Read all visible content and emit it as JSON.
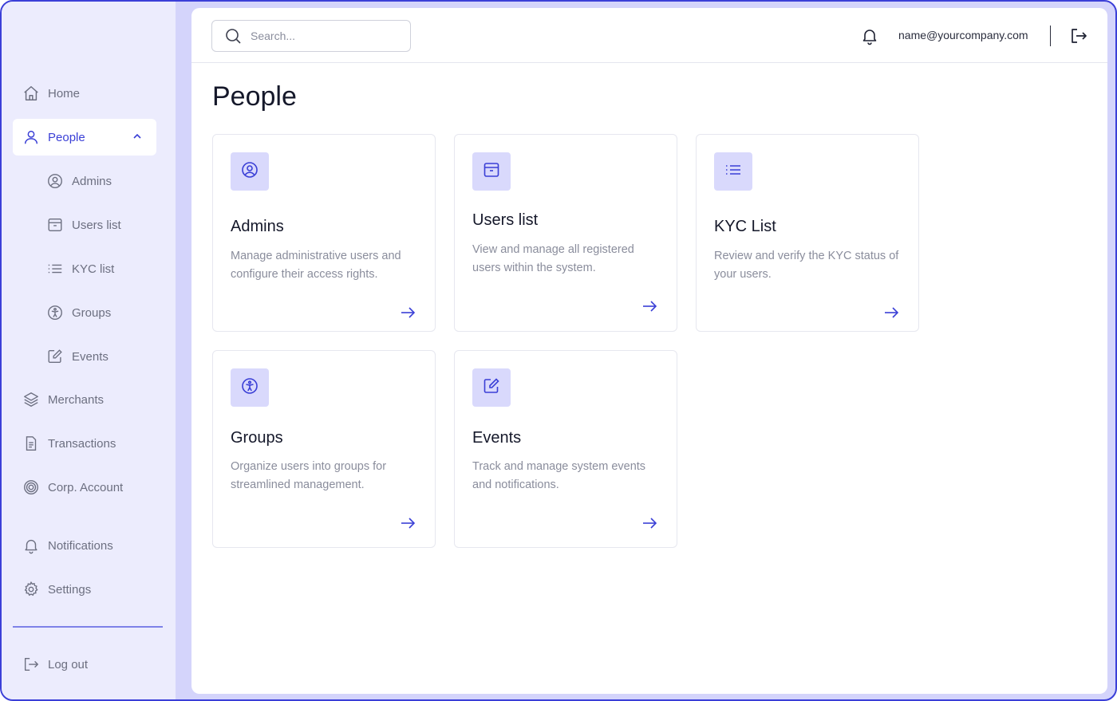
{
  "sidebar": {
    "items": [
      {
        "label": "Home",
        "icon": "home-icon"
      },
      {
        "label": "People",
        "icon": "user-icon",
        "active": true
      },
      {
        "label": "Admins",
        "icon": "user-circle-icon"
      },
      {
        "label": "Users list",
        "icon": "archive-box-icon"
      },
      {
        "label": "KYC list",
        "icon": "list-icon"
      },
      {
        "label": "Groups",
        "icon": "accessibility-icon"
      },
      {
        "label": "Events",
        "icon": "edit-square-icon"
      },
      {
        "label": "Merchants",
        "icon": "layers-icon"
      },
      {
        "label": "Transactions",
        "icon": "document-icon"
      },
      {
        "label": "Corp. Account",
        "icon": "target-icon"
      },
      {
        "label": "Notifications",
        "icon": "bell-icon"
      },
      {
        "label": "Settings",
        "icon": "gear-icon"
      }
    ],
    "logout_label": "Log out"
  },
  "header": {
    "search_placeholder": "Search...",
    "user_email": "name@yourcompany.com"
  },
  "page": {
    "title": "People",
    "cards": [
      {
        "title": "Admins",
        "description": "Manage administrative users and configure their access rights.",
        "icon": "user-circle-icon"
      },
      {
        "title": "Users list",
        "description": "View and manage all registered users within the system.",
        "icon": "archive-box-icon"
      },
      {
        "title": "KYC List",
        "description": "Review and verify the KYC status of your users.",
        "icon": "list-icon"
      },
      {
        "title": "Groups",
        "description": "Organize users into groups for streamlined management.",
        "icon": "accessibility-icon"
      },
      {
        "title": "Events",
        "description": "Track and manage system events and notifications.",
        "icon": "edit-square-icon"
      }
    ]
  },
  "colors": {
    "accent": "#3a3fd6",
    "sidebar_bg": "#ececfd",
    "frame_bg": "#d4d4fb",
    "icon_badge_bg": "#d9d9fc",
    "muted_text": "#8a8d9c"
  }
}
